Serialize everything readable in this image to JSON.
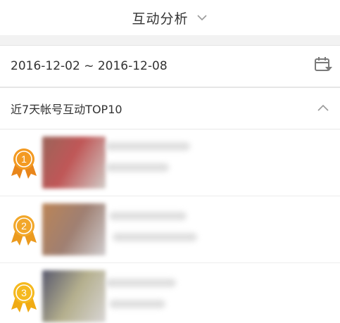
{
  "header": {
    "title": "互动分析",
    "chevron_icon": "chevron-down-icon",
    "accent_color": "#f08a24"
  },
  "date_range": {
    "text": "2016-12-02 ~ 2016-12-08",
    "icon": "calendar-icon"
  },
  "section": {
    "title": "近7天帐号互动TOP10",
    "toggle_icon": "chevron-up-icon"
  },
  "ranking": [
    {
      "rank": "1",
      "medal_color": "#f39a22",
      "thumb_colors": [
        "#8a4a3e",
        "#b53a3a",
        "#c9c2bd"
      ]
    },
    {
      "rank": "2",
      "medal_color": "#f2a72a",
      "thumb_colors": [
        "#b0703a",
        "#8f6a5a",
        "#c8c4c6"
      ]
    },
    {
      "rank": "3",
      "medal_color": "#f5b91f",
      "thumb_colors": [
        "#3b3c55",
        "#a8a27a",
        "#d2cfcf"
      ]
    }
  ]
}
